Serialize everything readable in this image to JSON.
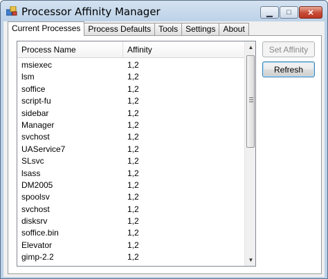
{
  "window": {
    "title": "Processor Affinity Manager",
    "minimize_glyph": "▁",
    "maximize_glyph": "□",
    "close_glyph": "✕"
  },
  "tabs": [
    {
      "label": "Current Processes",
      "active": true
    },
    {
      "label": "Process Defaults",
      "active": false
    },
    {
      "label": "Tools",
      "active": false
    },
    {
      "label": "Settings",
      "active": false
    },
    {
      "label": "About",
      "active": false
    }
  ],
  "list": {
    "columns": [
      "Process Name",
      "Affinity"
    ],
    "rows": [
      [
        "msiexec",
        "1,2"
      ],
      [
        "lsm",
        "1,2"
      ],
      [
        "soffice",
        "1,2"
      ],
      [
        "script-fu",
        "1,2"
      ],
      [
        "sidebar",
        "1,2"
      ],
      [
        "Manager",
        "1,2"
      ],
      [
        "svchost",
        "1,2"
      ],
      [
        "UAService7",
        "1,2"
      ],
      [
        "SLsvc",
        "1,2"
      ],
      [
        "lsass",
        "1,2"
      ],
      [
        "DM2005",
        "1,2"
      ],
      [
        "spoolsv",
        "1,2"
      ],
      [
        "svchost",
        "1,2"
      ],
      [
        "disksrv",
        "1,2"
      ],
      [
        "soffice.bin",
        "1,2"
      ],
      [
        "Elevator",
        "1,2"
      ],
      [
        "gimp-2.2",
        "1,2"
      ]
    ]
  },
  "scrollbar": {
    "up_glyph": "▲",
    "down_glyph": "▼"
  },
  "buttons": {
    "set_affinity": "Set Affinity",
    "refresh": "Refresh"
  },
  "colors": {
    "title_bar": "#bcd2e8",
    "close_button": "#c74b36",
    "disabled_text": "#8a8a8a"
  }
}
